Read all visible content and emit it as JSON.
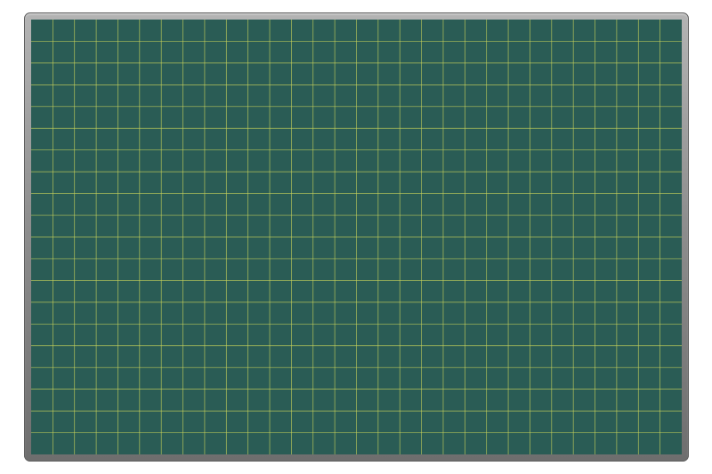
{
  "board": {
    "surface_color": "#2a5c55",
    "grid_color": "#c9d35a",
    "frame_color": "#8f8f8f",
    "grid_columns": 30,
    "grid_rows": 20
  }
}
